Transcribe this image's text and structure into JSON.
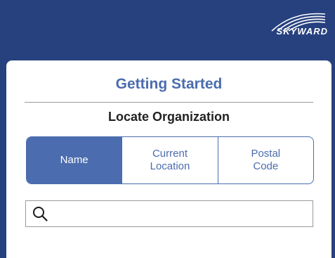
{
  "brand": {
    "logo_text": "SKYWARD",
    "header_color": "#27417f",
    "accent_color": "#4b6cae"
  },
  "card": {
    "title": "Getting Started",
    "subtitle": "Locate Organization"
  },
  "search_mode": {
    "selected": "Name",
    "options": [
      {
        "label": "Name"
      },
      {
        "label": "Current Location"
      },
      {
        "label": "Postal Code"
      }
    ]
  },
  "search": {
    "value": "",
    "placeholder": "",
    "icon": "search-icon"
  }
}
